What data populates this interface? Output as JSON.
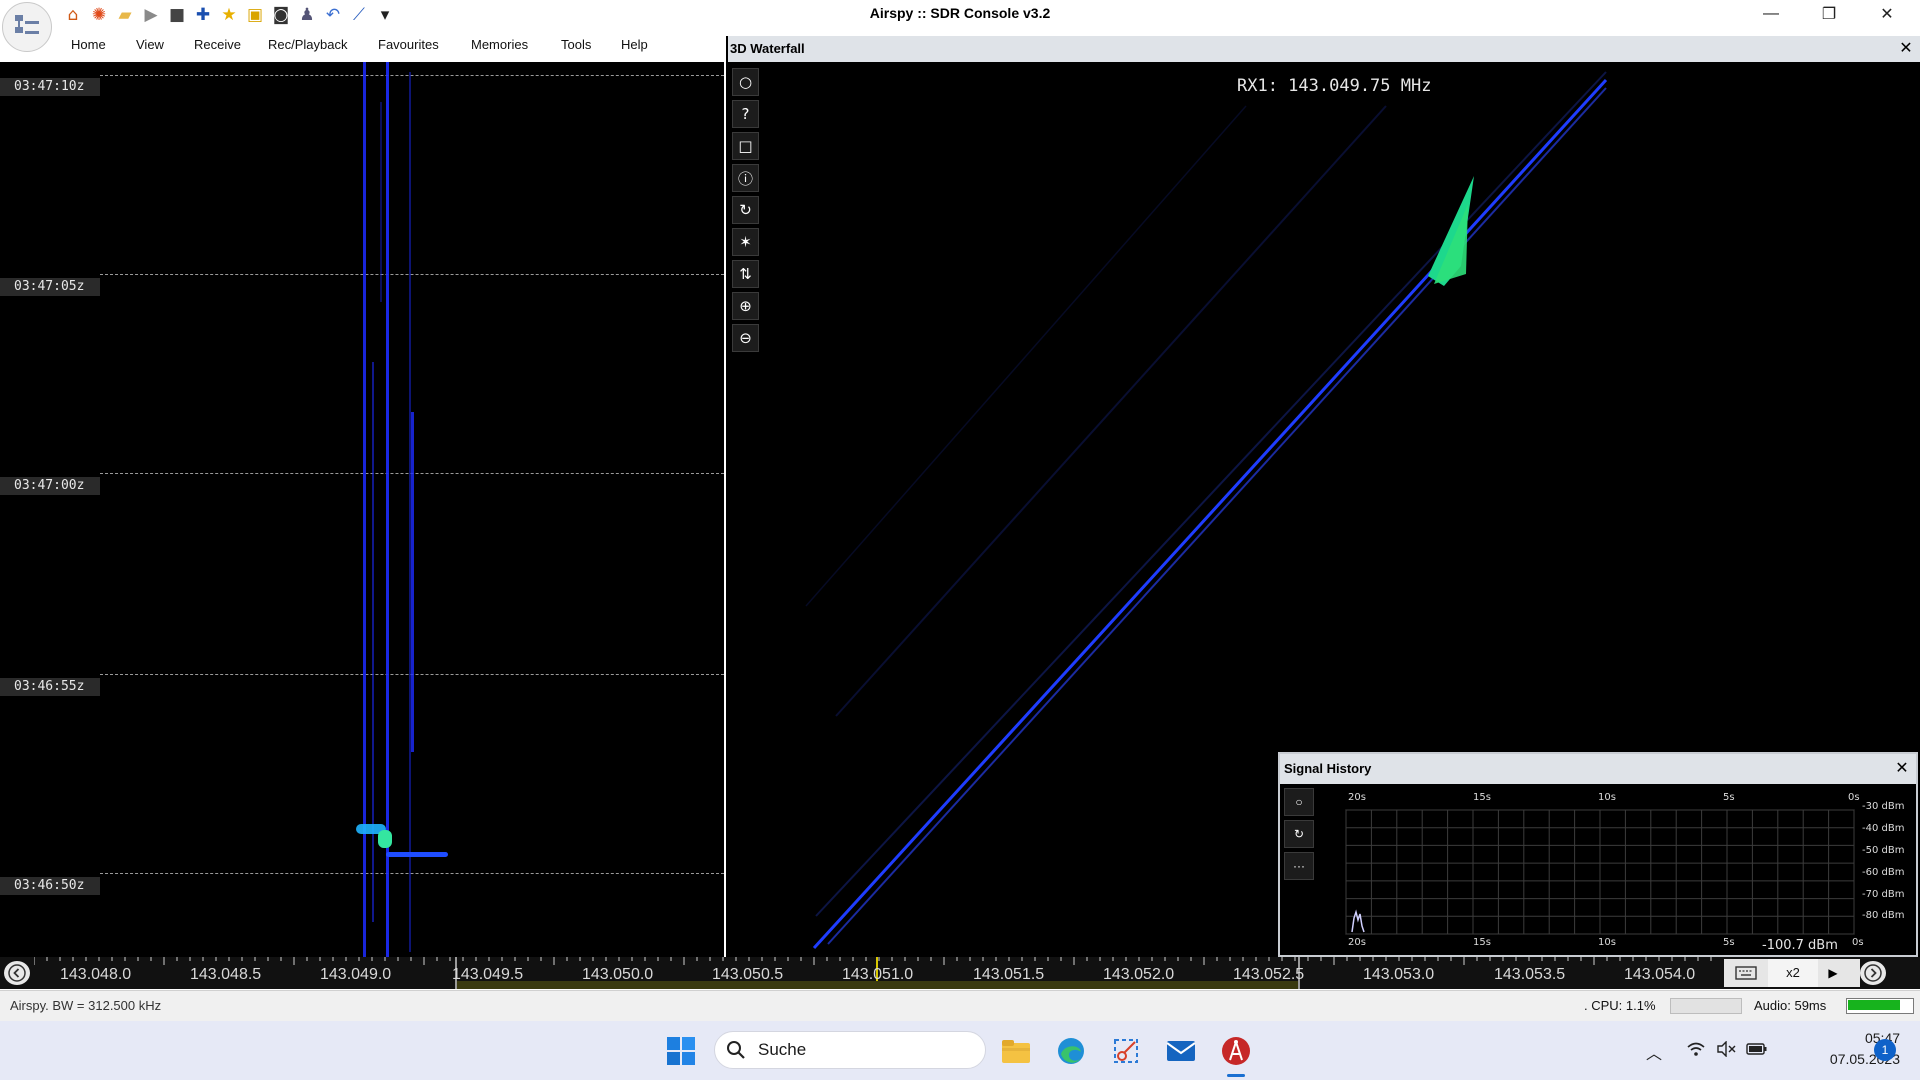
{
  "app": {
    "title": "Airspy :: SDR Console v3.2",
    "window_controls": {
      "minimize": "—",
      "restore": "❐",
      "close": "✕"
    },
    "quick_access": [
      {
        "icon": "home-icon",
        "glyph": "⌂",
        "color": "#d05a16"
      },
      {
        "icon": "lifebuoy-icon",
        "glyph": "✺",
        "color": "#e04a1a"
      },
      {
        "icon": "folder-open-icon",
        "glyph": "▰",
        "color": "#e8b84a"
      },
      {
        "icon": "play-icon",
        "glyph": "▶",
        "color": "#8a8a8a"
      },
      {
        "icon": "stop-icon",
        "glyph": "■",
        "color": "#444444"
      },
      {
        "icon": "add-icon",
        "glyph": "✚",
        "color": "#1a4fb0"
      },
      {
        "icon": "star-icon",
        "glyph": "★",
        "color": "#e8b000"
      },
      {
        "icon": "lock-icon",
        "glyph": "▣",
        "color": "#d9a400"
      },
      {
        "icon": "camera-icon",
        "glyph": "◙",
        "color": "#333333"
      },
      {
        "icon": "user-icon",
        "glyph": "♟",
        "color": "#555577"
      },
      {
        "icon": "undo-icon",
        "glyph": "↶",
        "color": "#3b6fd1"
      },
      {
        "icon": "spectrum-icon",
        "glyph": "⟋",
        "color": "#2b5fbf"
      },
      {
        "icon": "qat-dropdown-icon",
        "glyph": "▾",
        "color": "#222222"
      }
    ]
  },
  "menu": [
    "Home",
    "View",
    "Receive",
    "Rec/Playback",
    "Favourites",
    "Memories",
    "Tools",
    "Help"
  ],
  "left_waterfall": {
    "timestamps": [
      "03:47:10z",
      "03:47:05z",
      "03:47:00z",
      "03:46:55z",
      "03:46:50z"
    ]
  },
  "waterfall_3d": {
    "title": "3D Waterfall",
    "close": "✕",
    "rx_label": "RX1: 143.049.75 MHz",
    "tools": [
      {
        "name": "circle-mode-icon",
        "glyph": "○"
      },
      {
        "name": "help-icon",
        "glyph": "?"
      },
      {
        "name": "square-mode-icon",
        "glyph": "□"
      },
      {
        "name": "info-icon",
        "glyph": "ⓘ"
      },
      {
        "name": "rotate-icon",
        "glyph": "↻"
      },
      {
        "name": "asterisk-icon",
        "glyph": "✶"
      },
      {
        "name": "swap-vertical-icon",
        "glyph": "⇅"
      },
      {
        "name": "zoom-in-icon",
        "glyph": "⊕"
      },
      {
        "name": "zoom-out-icon",
        "glyph": "⊖"
      }
    ]
  },
  "signal_history": {
    "title": "Signal History",
    "close": "✕",
    "tools": [
      {
        "name": "circle-icon",
        "glyph": "○"
      },
      {
        "name": "refresh-icon",
        "glyph": "↻"
      },
      {
        "name": "more-icon",
        "glyph": "···"
      }
    ],
    "x_labels": [
      "20s",
      "15s",
      "10s",
      "5s",
      "0s"
    ],
    "x_labels_bottom": [
      "20s",
      "15s",
      "10s",
      "5s",
      "0s"
    ],
    "y_labels": [
      "-30 dBm",
      "-40 dBm",
      "-50 dBm",
      "-60 dBm",
      "-70 dBm",
      "-80 dBm"
    ],
    "current_level": "-100.7 dBm"
  },
  "frequency_scale": {
    "labels": [
      "143.048.0",
      "143.048.5",
      "143.049.0",
      "143.049.5",
      "143.050.0",
      "143.050.5",
      "143.051.0",
      "143.051.5",
      "143.052.0",
      "143.052.5",
      "143.053.0",
      "143.053.5",
      "143.054.0"
    ],
    "zoom": "x2"
  },
  "status": {
    "left": "Airspy. BW = 312.500 kHz",
    "cpu": ". CPU: 1.1%",
    "audio": "Audio: 59ms"
  },
  "taskbar": {
    "search_placeholder": "Suche",
    "time": "05:47",
    "date": "07.05.2023",
    "notifications": "1"
  }
}
